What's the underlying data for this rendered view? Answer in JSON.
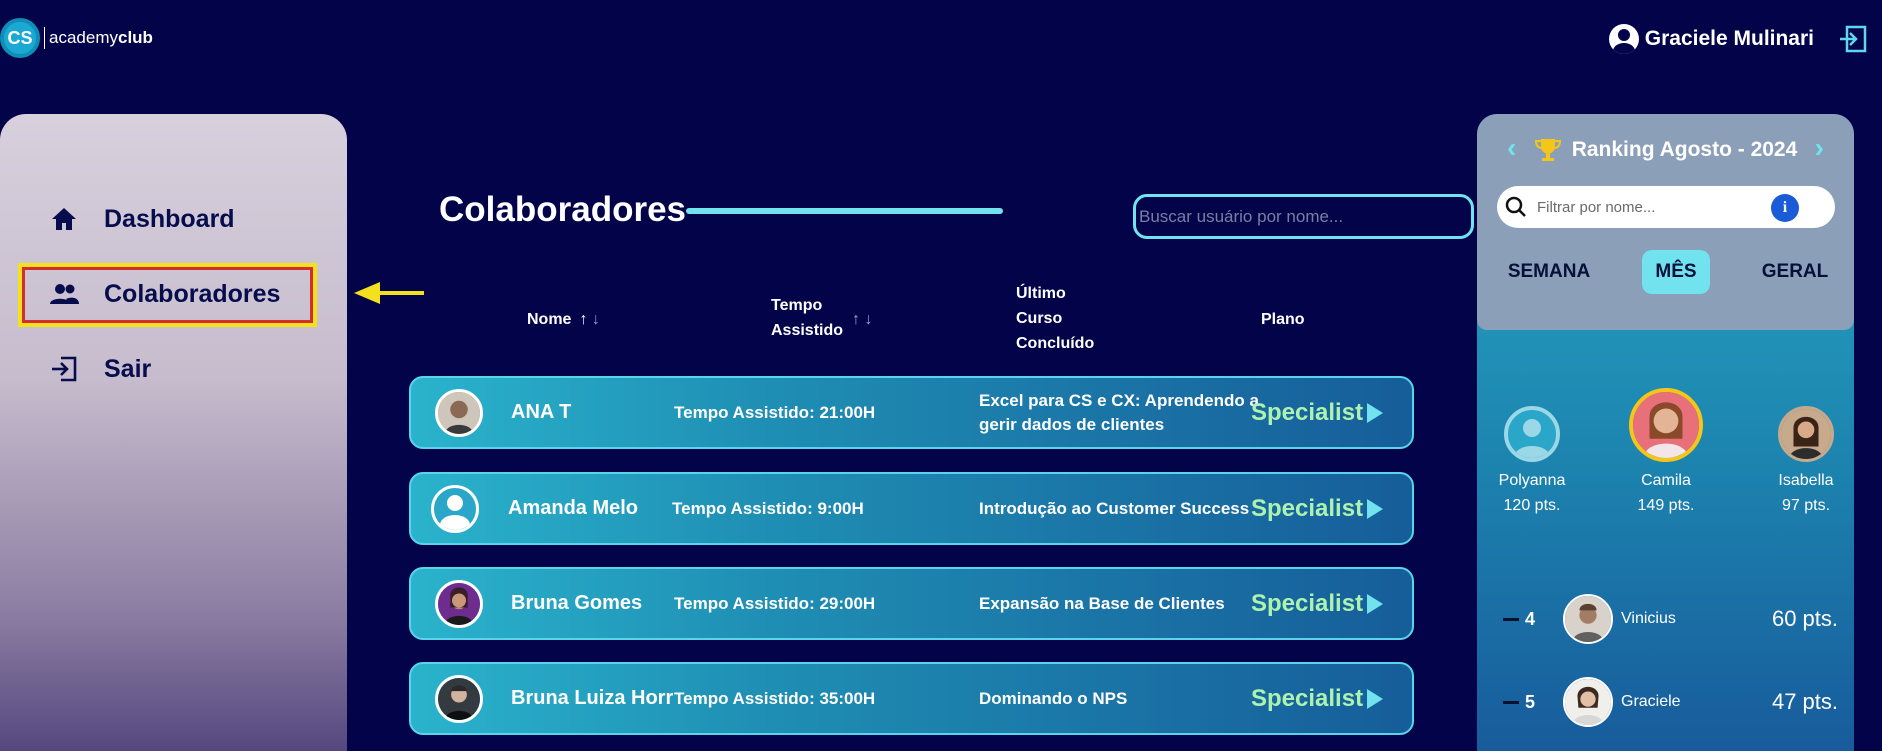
{
  "header": {
    "logo_mark": "CS",
    "logo_text_light": "academy",
    "logo_text_bold": "club",
    "user_name": "Graciele Mulinari",
    "logout_icon": "logout-icon"
  },
  "sidebar": {
    "items": [
      {
        "label": "Dashboard",
        "icon": "home-icon"
      },
      {
        "label": "Colaboradores",
        "icon": "people-icon"
      },
      {
        "label": "Sair",
        "icon": "exit-icon"
      }
    ]
  },
  "main": {
    "title": "Colaboradores",
    "search_placeholder": "Buscar usuário por nome...",
    "columns": {
      "name": "Nome",
      "time_1": "Tempo",
      "time_2": "Assistido",
      "course_1": "Último",
      "course_2": "Curso",
      "course_3": "Concluído",
      "plan": "Plano"
    },
    "rows": [
      {
        "name": "ANA T",
        "time": "Tempo Assistido: 21:00H",
        "course": "Excel para CS e CX: Aprendendo a gerir dados de clientes",
        "plan": "Specialist"
      },
      {
        "name": "Amanda Melo",
        "time": "Tempo Assistido: 9:00H",
        "course": "Introdução ao Customer Success",
        "plan": "Specialist"
      },
      {
        "name": "Bruna Gomes",
        "time": "Tempo Assistido: 29:00H",
        "course": "Expansão na Base de Clientes",
        "plan": "Specialist"
      },
      {
        "name": "Bruna Luiza Horr",
        "time": "Tempo Assistido: 35:00H",
        "course": "Dominando o NPS",
        "plan": "Specialist"
      }
    ]
  },
  "ranking": {
    "title": "Ranking Agosto - 2024",
    "filter_placeholder": "Filtrar por nome...",
    "tabs": [
      "SEMANA",
      "MÊS",
      "GERAL"
    ],
    "active_tab": "MÊS",
    "podium": [
      {
        "name": "Polyanna",
        "points": "120 pts."
      },
      {
        "name": "Camila",
        "points": "149 pts."
      },
      {
        "name": "Isabella",
        "points": "97 pts."
      }
    ],
    "list": [
      {
        "position": "4",
        "name": "Vinicius",
        "points": "60 pts."
      },
      {
        "position": "5",
        "name": "Graciele",
        "points": "47 pts."
      }
    ]
  },
  "colors": {
    "background": "#03034a",
    "accent": "#72e2ee",
    "plan": "#adf2b0",
    "highlight_yellow": "#f3e11d"
  }
}
